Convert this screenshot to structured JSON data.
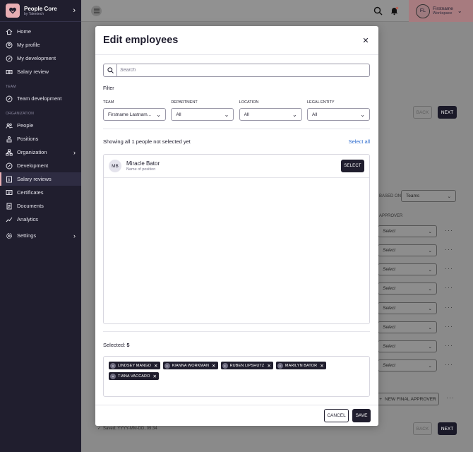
{
  "brand": {
    "name": "People Core",
    "sub": "by Talentech"
  },
  "nav": {
    "items_top": [
      {
        "label": "Home",
        "icon": "home-icon"
      },
      {
        "label": "My profile",
        "icon": "profile-icon"
      },
      {
        "label": "My development",
        "icon": "development-icon"
      },
      {
        "label": "Salary review",
        "icon": "salary-icon"
      }
    ],
    "section_team": "TEAM",
    "team_item": "Team development",
    "section_org": "ORGANIZATION",
    "org_items": [
      "People",
      "Positions",
      "Organization",
      "Development",
      "Salary reviews",
      "Certificates",
      "Documents",
      "Analytics"
    ],
    "settings": "Settings"
  },
  "user": {
    "initials": "FL",
    "name": "Firstname",
    "workspace": "Workspace"
  },
  "background": {
    "back": "BACK",
    "next": "NEXT",
    "based_on": "BASED ON",
    "based_on_value": "Teams",
    "approver_header": "APPROVER",
    "select_placeholder": "Select",
    "new_final_approver": "NEW FINAL APPROVER",
    "saved": "Saved: YYYY-MM-DD, 09:34"
  },
  "modal": {
    "title": "Edit employees",
    "search_placeholder": "Search",
    "filter_label": "Filter",
    "filters": [
      {
        "name": "TEAM",
        "value": "Firstname Lastnam..."
      },
      {
        "name": "DEPARTMENT",
        "value": "All"
      },
      {
        "name": "LOCATION",
        "value": "All"
      },
      {
        "name": "LEGAL ENTITY",
        "value": "All"
      }
    ],
    "showing": "Showing all 1 people not selected yet",
    "select_all": "Select all",
    "person": {
      "initials": "MB",
      "name": "Miracle Bator",
      "position": "Name of position",
      "action": "SELECT"
    },
    "selected_label": "Selected:",
    "selected_count": "5",
    "chips": [
      "LINDSEY MANGO",
      "KIANNA WORKMAN",
      "RUBEN LIPSHUTZ",
      "MARILYN BATOR",
      "TIANA VACCARO"
    ],
    "cancel": "CANCEL",
    "save": "SAVE"
  }
}
